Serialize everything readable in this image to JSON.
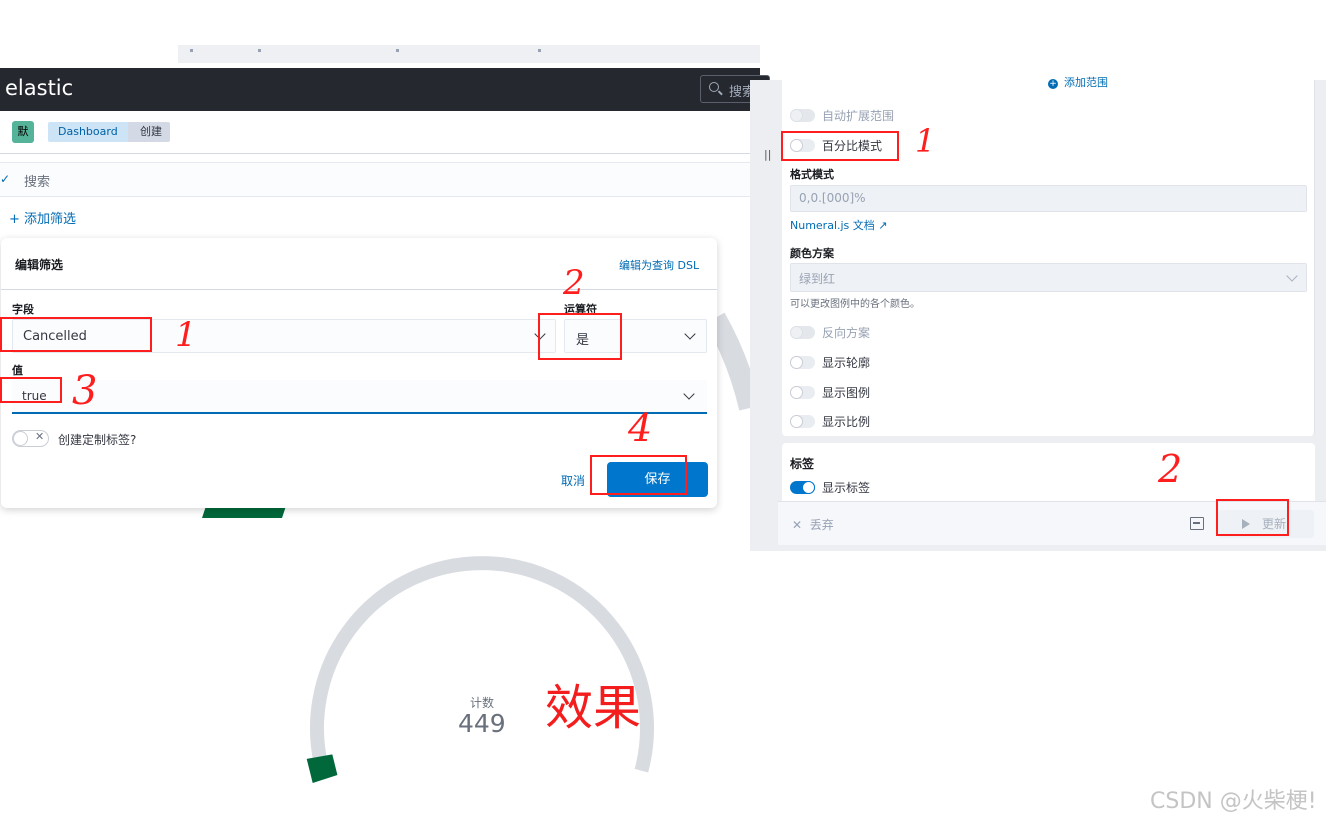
{
  "left": {
    "logo": "elastic",
    "search_placeholder": "搜索",
    "space_avatar": "默",
    "breadcrumb": [
      "Dashboard",
      "创建"
    ],
    "query_placeholder": "搜索",
    "add_filter": "+ 添加筛选",
    "filter_editor": {
      "title": "编辑筛选",
      "edit_dsl": "编辑为查询 DSL",
      "field_label": "字段",
      "field_value": "Cancelled",
      "operator_label": "运算符",
      "operator_value": "是",
      "value_label": "值",
      "value_value": "true",
      "custom_label": "创建定制标签?",
      "cancel": "取消",
      "save": "保存"
    }
  },
  "right": {
    "add_range": "添加范围",
    "toggles": [
      {
        "label": "自动扩展范围",
        "state": "disabled-off"
      },
      {
        "label": "百分比模式",
        "state": "off"
      },
      {
        "label": "反向方案",
        "state": "disabled-off"
      },
      {
        "label": "显示轮廓",
        "state": "off"
      },
      {
        "label": "显示图例",
        "state": "off"
      },
      {
        "label": "显示比例",
        "state": "off"
      }
    ],
    "format_label": "格式模式",
    "format_value": "0,0.[000]%",
    "numeral_link": "Numeral.js 文档",
    "color_scheme_label": "颜色方案",
    "color_scheme_value": "绿到红",
    "color_help": "可以更改图例中的各个颜色。",
    "labels_section": "标签",
    "show_labels": "显示标签",
    "discard": "丢弃",
    "update": "更新"
  },
  "gauge": {
    "metric_label": "计数",
    "metric_value": "449",
    "arc_color": "#00683a",
    "track_color": "#d8dbe0"
  },
  "annotations": {
    "marks": [
      "1",
      "2",
      "3",
      "4",
      "1",
      "2"
    ],
    "effect": "效果",
    "watermark": "CSDN @火柴梗!"
  }
}
